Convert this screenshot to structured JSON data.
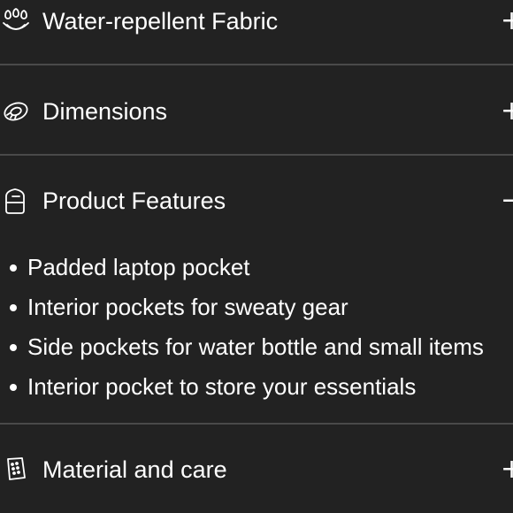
{
  "accordion": {
    "items": [
      {
        "label": "Water-repellent Fabric",
        "icon": "water-drops-icon",
        "toggle": "+"
      },
      {
        "label": "Dimensions",
        "icon": "tape-measure-icon",
        "toggle": "+"
      },
      {
        "label": "Product Features",
        "icon": "bag-icon",
        "toggle": "−"
      },
      {
        "label": "Material and care",
        "icon": "fabric-tag-icon",
        "toggle": "+"
      }
    ],
    "features": [
      "Padded laptop pocket",
      "Interior pockets for sweaty gear",
      "Side pockets for water bottle and small items",
      "Interior pocket to store your essentials"
    ]
  },
  "colors": {
    "background": "#222222",
    "text": "#ffffff",
    "divider": "#4a4a4a"
  }
}
